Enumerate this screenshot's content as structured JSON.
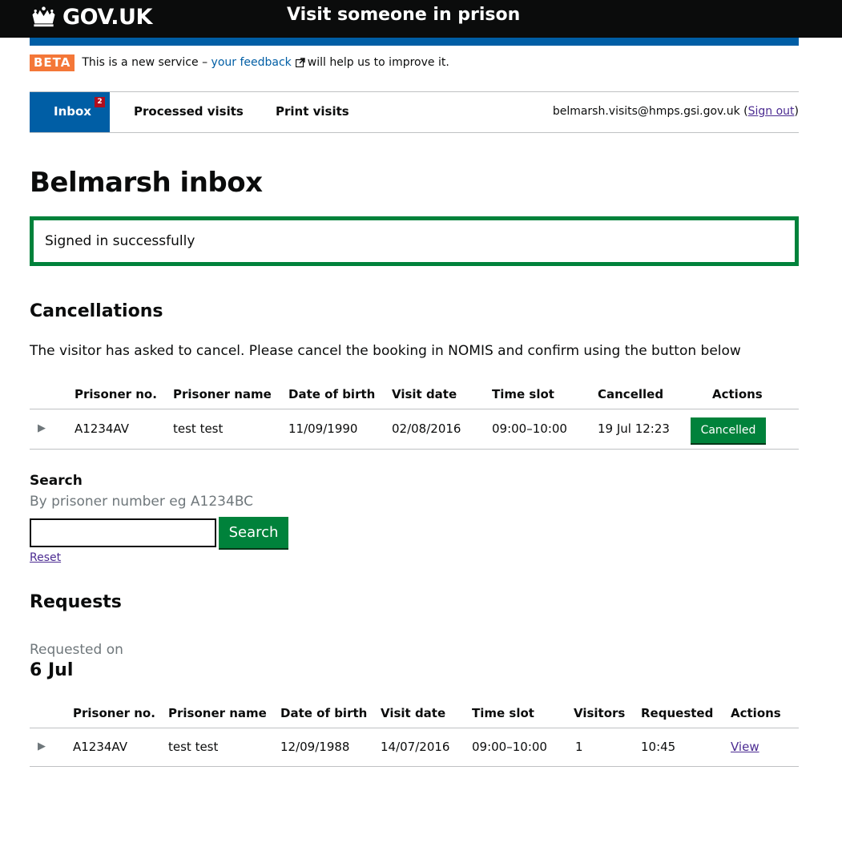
{
  "header": {
    "logo_text": "GOV.UK",
    "service_name": "Visit someone in prison"
  },
  "phase": {
    "tag": "BETA",
    "text_before": "This is a new service –",
    "feedback_link": "your feedback",
    "text_after": "will help us to improve it."
  },
  "nav": {
    "inbox": "Inbox",
    "inbox_count": "2",
    "processed": "Processed visits",
    "print": "Print visits",
    "user_email": "belmarsh.visits@hmps.gsi.gov.uk",
    "open_paren": "(",
    "sign_out": "Sign out",
    "close_paren": ")"
  },
  "page_title": "Belmarsh inbox",
  "flash": "Signed in successfully",
  "cancellations": {
    "heading": "Cancellations",
    "description": "The visitor has asked to cancel. Please cancel the booking in NOMIS and confirm using the button below",
    "columns": [
      "Prisoner no.",
      "Prisoner name",
      "Date of birth",
      "Visit date",
      "Time slot",
      "Cancelled",
      "Actions"
    ],
    "rows": [
      {
        "toggle": "▶",
        "prisoner_no": "A1234AV",
        "prisoner_name": "test test",
        "dob": "11/09/1990",
        "visit_date": "02/08/2016",
        "time_slot": "09:00–10:00",
        "cancelled": "19 Jul 12:23",
        "action": "Cancelled"
      }
    ]
  },
  "search": {
    "label": "Search",
    "hint": "By prisoner number eg A1234BC",
    "value": "",
    "button": "Search",
    "reset": "Reset"
  },
  "requests": {
    "heading": "Requests",
    "requested_on_label": "Requested on",
    "requested_on_date": "6 Jul",
    "columns": [
      "Prisoner no.",
      "Prisoner name",
      "Date of birth",
      "Visit date",
      "Time slot",
      "Visitors",
      "Requested",
      "Actions"
    ],
    "rows": [
      {
        "toggle": "▶",
        "prisoner_no": "A1234AV",
        "prisoner_name": "test test",
        "dob": "12/09/1988",
        "visit_date": "14/07/2016",
        "time_slot": "09:00–10:00",
        "visitors": "1",
        "requested": "10:45",
        "action": "View"
      }
    ]
  },
  "colors": {
    "header_bg": "#0b0c0c",
    "brand_blue": "#005ea5",
    "beta_orange": "#f47738",
    "success_green": "#00823b",
    "badge_red": "#b10e1e",
    "link_visited": "#4c2c92"
  }
}
